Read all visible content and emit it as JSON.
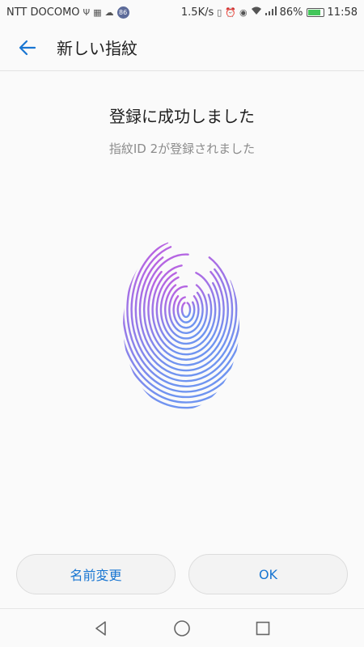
{
  "status_bar": {
    "carrier": "NTT DOCOMO",
    "speed": "1.5K/s",
    "notification_badge": "86",
    "battery_percent": "86%",
    "time": "11:58",
    "battery_level": 0.86,
    "battery_color": "#43c65a",
    "icons": [
      "usb-icon",
      "sim-icon",
      "cloud-icon",
      "vibrate-icon",
      "alarm-icon",
      "eye-icon",
      "wifi-icon",
      "signal-icon",
      "battery-icon"
    ]
  },
  "app_bar": {
    "title": "新しい指紋",
    "back_icon": "arrow-left-icon",
    "accent": "#1976d2"
  },
  "content": {
    "title": "登録に成功しました",
    "subtitle": "指紋ID 2が登録されました",
    "fingerprint_icon": "fingerprint-icon",
    "gradient_top": "#c05ee0",
    "gradient_bottom": "#6f94f0"
  },
  "buttons": {
    "rename_label": "名前変更",
    "ok_label": "OK"
  },
  "nav_bar": {
    "back_icon": "nav-back-icon",
    "home_icon": "nav-home-icon",
    "recents_icon": "nav-recents-icon"
  }
}
